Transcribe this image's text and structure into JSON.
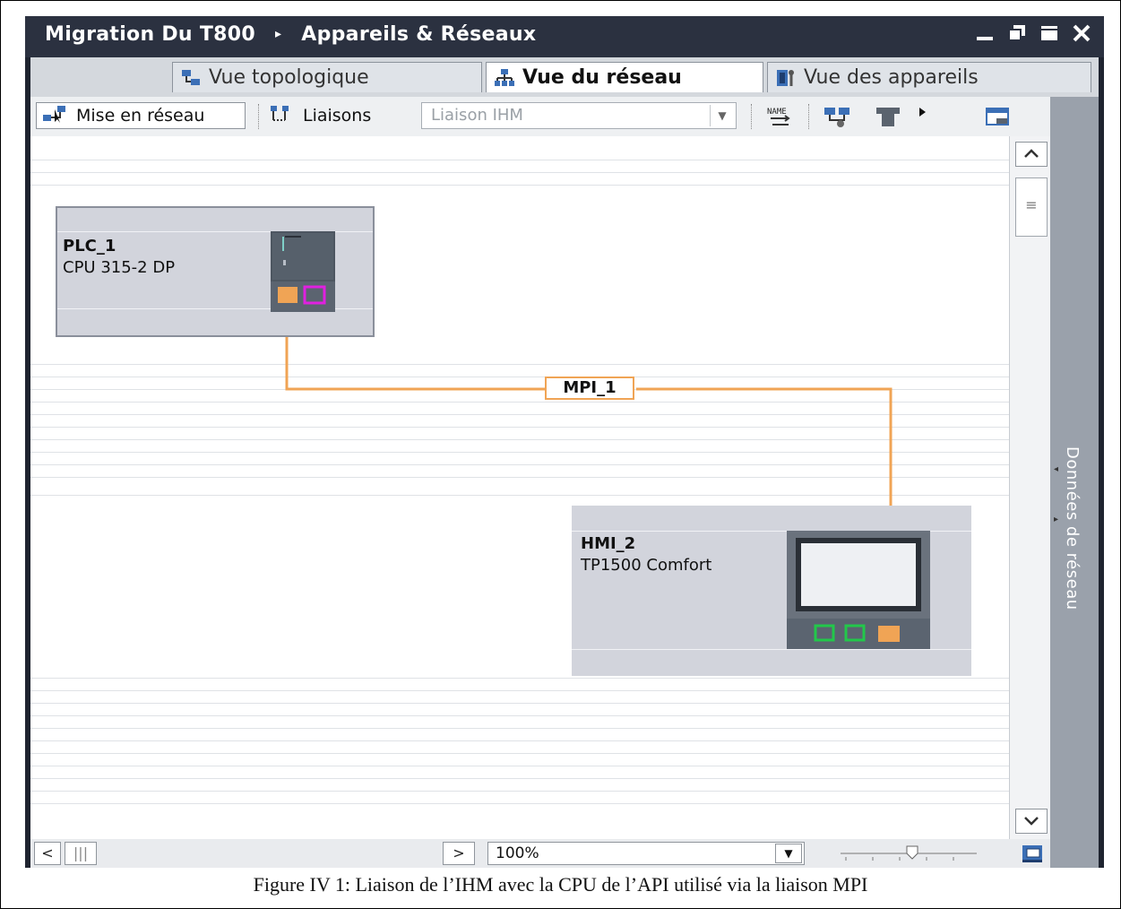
{
  "window": {
    "title_project": "Migration Du T800",
    "title_separator": "▸",
    "title_section": "Appareils & Réseaux",
    "controls": [
      "minimize-icon",
      "restore-icon",
      "maximize-icon",
      "close-icon"
    ]
  },
  "tabs": [
    {
      "label": "Vue topologique",
      "icon": "topology-icon",
      "active": false
    },
    {
      "label": "Vue du réseau",
      "icon": "network-icon",
      "active": true
    },
    {
      "label": "Vue des appareils",
      "icon": "devices-icon",
      "active": false
    }
  ],
  "toolbar": {
    "networking_label": "Mise en réseau",
    "connections_label": "Liaisons",
    "connection_type_value": "Liaison IHM",
    "icons": [
      "name-icon",
      "show-address-icon",
      "module-icon",
      "more-arrow-icon",
      "table-view-icon"
    ]
  },
  "devices": [
    {
      "name": "PLC_1",
      "type": "CPU 315-2 DP"
    },
    {
      "name": "HMI_2",
      "type": "TP1500 Comfort"
    }
  ],
  "network": {
    "label": "MPI_1",
    "color": "#f0a455"
  },
  "side_panel": {
    "label": "Données de réseau"
  },
  "bottom": {
    "zoom_value": "100%"
  },
  "caption": "Figure IV 1: Liaison de l’IHM avec la CPU de l’API utilisé via la liaison MPI",
  "colors": {
    "accent_orange": "#f0a455",
    "port_magenta": "#e020e0",
    "port_green": "#22c84a"
  }
}
